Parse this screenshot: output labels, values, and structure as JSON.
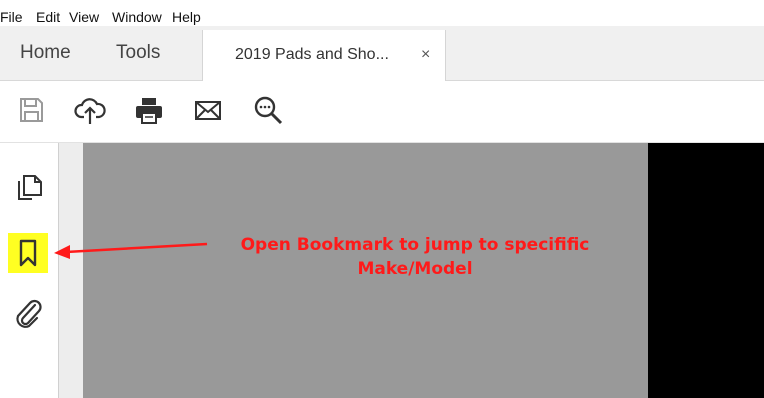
{
  "menu": {
    "file": "File",
    "edit": "Edit",
    "view": "View",
    "window": "Window",
    "help": "Help"
  },
  "tabs": {
    "home": "Home",
    "tools": "Tools",
    "document": "2019 Pads and Sho...",
    "close_glyph": "×"
  },
  "toolbar": {
    "icons": [
      "save-icon",
      "upload-cloud-icon",
      "print-icon",
      "email-icon",
      "search-zoom-icon"
    ]
  },
  "left_rail": {
    "icons": [
      "page-thumbnails-icon",
      "bookmark-icon",
      "attachment-icon"
    ],
    "highlight_color": "#ffff22"
  },
  "annotation": {
    "line1": "Open Bookmark to jump to specifific",
    "line2": "Make/Model",
    "color": "#ff1a1a"
  },
  "colors": {
    "page_background": "#999999",
    "tab_bar": "#f0f0f0",
    "right_panel": "#000000"
  }
}
